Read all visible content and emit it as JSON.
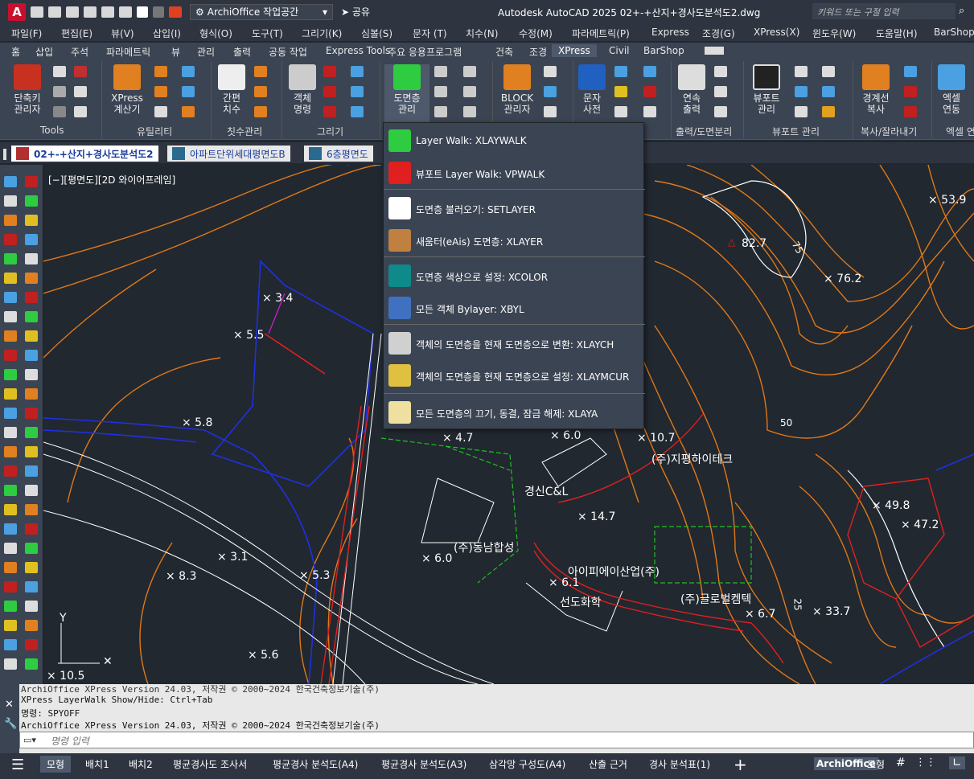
{
  "titlebar": {
    "app_letter": "A",
    "workspace": "ArchiOffice 작업공간",
    "share": "공유",
    "title": "Autodesk AutoCAD 2025    02+-+산지+경사도분석도2.dwg",
    "search_placeholder": "키워드 또는 구절 입력"
  },
  "menu": [
    "파일(F)",
    "편집(E)",
    "뷰(V)",
    "삽입(I)",
    "형식(O)",
    "도구(T)",
    "그리기(K)",
    "심볼(S)",
    "문자 (T)",
    "치수(N)",
    "수정(M)",
    "파라메트릭(P)",
    "Express",
    "조경(G)",
    "XPress(X)",
    "윈도우(W)",
    "도움말(H)",
    "BarShop"
  ],
  "ribbon_tabs": [
    "홈",
    "삽입",
    "주석",
    "파라메트릭",
    "뷰",
    "관리",
    "출력",
    "공동 작업",
    "Express Tools",
    "주요 응용프로그램",
    "건축",
    "조경",
    "XPress",
    "Civil",
    "BarShop"
  ],
  "active_tab": "XPress",
  "ribbon": {
    "buttons": [
      "단축키\n관리자",
      "XPress\n계산기",
      "간편\n치수",
      "객체\n명령",
      "도면층\n관리",
      "BLOCK\n관리자",
      "문자\n사전",
      "연속\n출력",
      "뷰포트\n관리",
      "경계선\n복사",
      "엑셀\n연동"
    ],
    "panels": [
      "Tools",
      "유틸리티",
      "칫수관리",
      "그리기",
      "출력/도면분리",
      "뷰포트 관리",
      "복사/잘라내기",
      "엑셀 연"
    ]
  },
  "doc_tabs": [
    "02+-+산지+경사도분석도2",
    "아파트단위세대평면도B",
    "6층평면도"
  ],
  "viewport_label": "[−][평면도][2D 와이어프레임]",
  "dropdown": [
    {
      "label": "Layer Walk: XLAYWALK",
      "icon": "green-footprints-icon",
      "color": "#2ecc40"
    },
    {
      "label": "뷰포트 Layer Walk: VPWALK",
      "icon": "red-footprints-icon",
      "color": "#e02020"
    },
    {
      "label": "도면층 불러오기: SETLAYER",
      "icon": "layer-import-icon",
      "color": "#ffffff"
    },
    {
      "label": "새움터(eAis) 도면층: XLAYER",
      "icon": "eais-layer-icon",
      "color": "#c08040"
    },
    {
      "label": "도면층 색상으로 설정: XCOLOR",
      "icon": "layer-color-icon",
      "color": "#0e8a8a"
    },
    {
      "label": "모든 객체 Bylayer: XBYL",
      "icon": "bylayer-pencil-icon",
      "color": "#4070c0"
    },
    {
      "label": "객체의 도면층을 현재 도면층으로 변환: XLAYCH",
      "icon": "layer-change-icon",
      "color": "#d0d0d0"
    },
    {
      "label": "객체의 도면층을 현재 도면층으로 설정: XLAYMCUR",
      "icon": "layer-set-current-icon",
      "color": "#e0c040"
    },
    {
      "label": "모든 도면층의 끄기, 동결, 잠금 해제: XLAYA",
      "icon": "layer-unlock-icon",
      "color": "#f0e0a0"
    }
  ],
  "spot_heights": [
    "× 3.4",
    "× 5.5",
    "× 5.8",
    "× 4.7",
    "× 6.0",
    "× 10.7",
    "× 14.7",
    "× 6.0",
    "× 6.1",
    "× 3.1",
    "× 8.3",
    "× 5.3",
    "× 5.6",
    "× 10.5",
    "× 6.7",
    "× 49.8",
    "× 47.2",
    "× 33.7",
    "× 76.2",
    "× 53.9",
    "82.7"
  ],
  "contour_labels": [
    "50",
    "75",
    "25"
  ],
  "site_labels": [
    "(주)지평하이테크",
    "경신C&L",
    "(주)동남합성",
    "아이피에이산업(주)",
    "선도화학",
    "(주)글로벌켐텍"
  ],
  "command_lines": [
    "ArchiOffice XPress Version 24.03, 저작권 © 2000~2024 한국건축정보기술(주)",
    "XPress LayerWalk Show/Hide: Ctrl+Tab",
    "명령: SPYOFF",
    "ArchiOffice XPress Version 24.03, 저작권 © 2000~2024 한국건축정보기술(주)"
  ],
  "command_placeholder": "명령 입력",
  "layout_tabs": [
    "모형",
    "배치1",
    "배치2",
    "평균경사도 조사서",
    "평균경사 분석도(A4)",
    "평균경사 분석도(A3)",
    "삼각망 구성도(A4)",
    "산출 근거",
    "경사 분석표(1)"
  ],
  "status": {
    "archioffice": "ArchiOffice",
    "model": "모형"
  }
}
